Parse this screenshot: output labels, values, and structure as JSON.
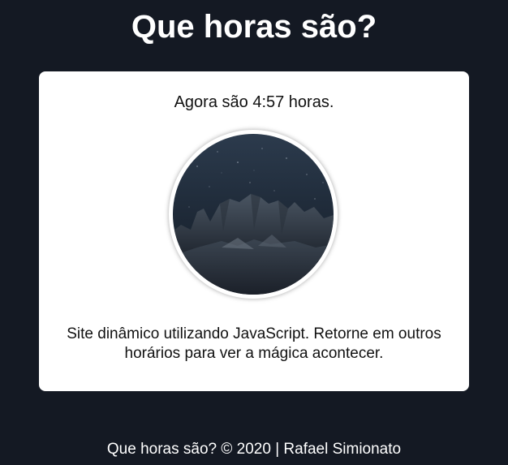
{
  "header": {
    "title": "Que horas são?"
  },
  "card": {
    "time_text": "Agora são 4:57 horas.",
    "image": {
      "subject": "night sky over rocky mountains"
    },
    "description": "Site dinâmico utilizando JavaScript. Retorne em outros horários para ver a mágica acontecer."
  },
  "footer": {
    "text": "Que horas são? © 2020 | Rafael Simionato"
  },
  "colors": {
    "background": "#141923",
    "card": "#ffffff",
    "text_dark": "#111111",
    "text_light": "#ffffff"
  }
}
